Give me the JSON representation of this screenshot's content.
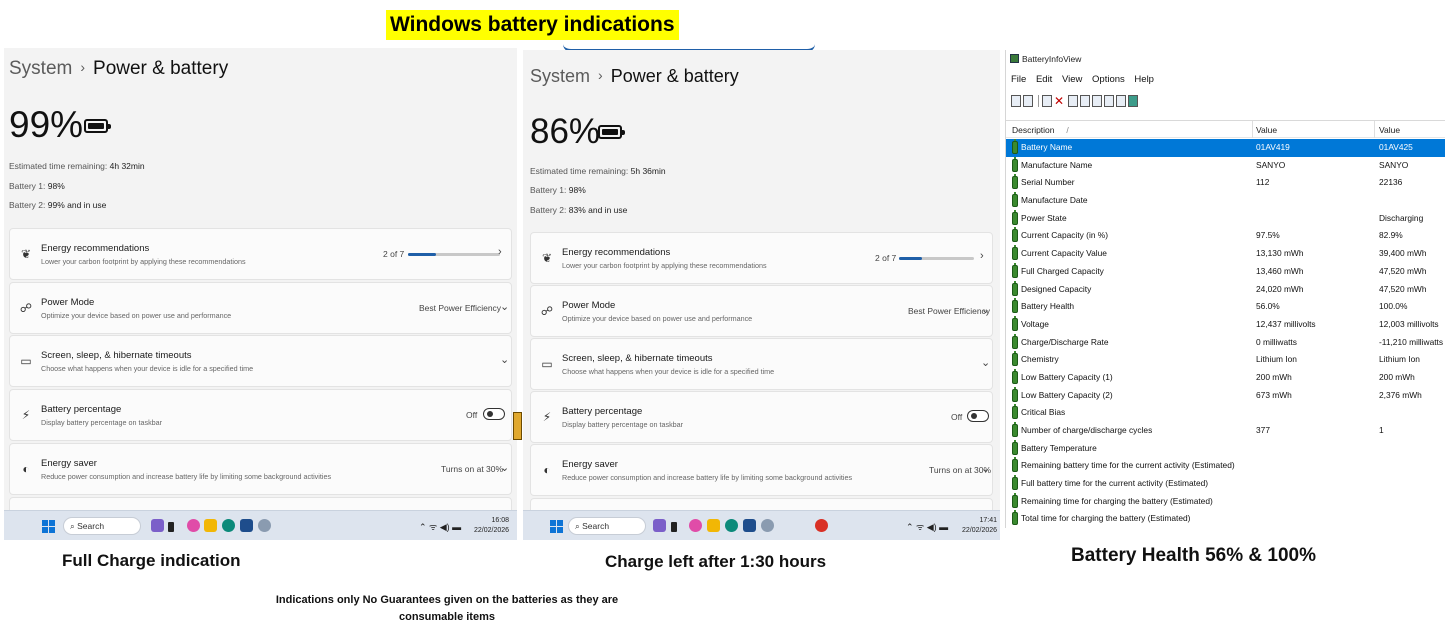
{
  "page_title": "Windows battery indications",
  "settings_panels": [
    {
      "breadcrumb_root": "System",
      "breadcrumb_current": "Power & battery",
      "percent": "99%",
      "estimated_label": "Estimated time remaining:",
      "estimated_value": "4h 32min",
      "battery1_label": "Battery 1:",
      "battery1_value": "98%",
      "battery2_label": "Battery 2:",
      "battery2_value": "99% and in use",
      "energy_recommendations": {
        "title": "Energy recommendations",
        "subtitle": "Lower your carbon footprint by applying these recommendations",
        "value": "2 of 7",
        "progress_fraction": 0.3
      },
      "power_mode": {
        "title": "Power Mode",
        "subtitle": "Optimize your device based on power use and performance",
        "value": "Best Power Efficiency"
      },
      "screen_sleep": {
        "title": "Screen, sleep, & hibernate timeouts",
        "subtitle": "Choose what happens when your device is idle for a specified time"
      },
      "battery_percentage": {
        "title": "Battery percentage",
        "subtitle": "Display battery percentage on taskbar",
        "value": "Off"
      },
      "energy_saver": {
        "title": "Energy saver",
        "subtitle": "Reduce power consumption and increase battery life by limiting some background activities",
        "value": "Turns on at 30%"
      },
      "taskbar": {
        "search": "Search",
        "time": "16:08",
        "date": "22/02/2026"
      }
    },
    {
      "breadcrumb_root": "System",
      "breadcrumb_current": "Power & battery",
      "percent": "86%",
      "estimated_label": "Estimated time remaining:",
      "estimated_value": "5h 36min",
      "battery1_label": "Battery 1:",
      "battery1_value": "98%",
      "battery2_label": "Battery 2:",
      "battery2_value": "83% and in use",
      "energy_recommendations": {
        "title": "Energy recommendations",
        "subtitle": "Lower your carbon footprint by applying these recommendations",
        "value": "2 of 7",
        "progress_fraction": 0.3
      },
      "power_mode": {
        "title": "Power Mode",
        "subtitle": "Optimize your device based on power use and performance",
        "value": "Best Power Efficiency"
      },
      "screen_sleep": {
        "title": "Screen, sleep, & hibernate timeouts",
        "subtitle": "Choose what happens when your device is idle for a specified time"
      },
      "battery_percentage": {
        "title": "Battery percentage",
        "subtitle": "Display battery percentage on taskbar",
        "value": "Off"
      },
      "energy_saver": {
        "title": "Energy saver",
        "subtitle": "Reduce power consumption and increase battery life by limiting some background activities",
        "value": "Turns on at 30%"
      },
      "taskbar": {
        "search": "Search",
        "time": "17:41",
        "date": "22/02/2026"
      }
    }
  ],
  "battery_info_view": {
    "title": "BatteryInfoView",
    "menu": [
      "File",
      "Edit",
      "View",
      "Options",
      "Help"
    ],
    "columns": [
      "Description",
      "Value",
      "Value"
    ],
    "sort_mark": "/",
    "rows": [
      {
        "desc": "Battery Name",
        "v1": "01AV419",
        "v2": "01AV425"
      },
      {
        "desc": "Manufacture Name",
        "v1": "SANYO",
        "v2": "SANYO"
      },
      {
        "desc": "Serial Number",
        "v1": " 112",
        "v2": "22136"
      },
      {
        "desc": "Manufacture Date",
        "v1": "",
        "v2": ""
      },
      {
        "desc": "Power State",
        "v1": "",
        "v2": "Discharging"
      },
      {
        "desc": "Current Capacity (in %)",
        "v1": "97.5%",
        "v2": "82.9%"
      },
      {
        "desc": "Current Capacity Value",
        "v1": "13,130 mWh",
        "v2": "39,400 mWh"
      },
      {
        "desc": "Full Charged Capacity",
        "v1": "13,460 mWh",
        "v2": "47,520 mWh"
      },
      {
        "desc": "Designed Capacity",
        "v1": "24,020 mWh",
        "v2": "47,520 mWh"
      },
      {
        "desc": "Battery Health",
        "v1": "56.0%",
        "v2": "100.0%"
      },
      {
        "desc": "Voltage",
        "v1": "12,437 millivolts",
        "v2": "12,003 millivolts"
      },
      {
        "desc": "Charge/Discharge Rate",
        "v1": "0 milliwatts",
        "v2": "-11,210 milliwatts"
      },
      {
        "desc": "Chemistry",
        "v1": "Lithium Ion",
        "v2": "Lithium Ion"
      },
      {
        "desc": "Low Battery Capacity (1)",
        "v1": "200 mWh",
        "v2": "200 mWh"
      },
      {
        "desc": "Low Battery Capacity (2)",
        "v1": "673 mWh",
        "v2": "2,376 mWh"
      },
      {
        "desc": "Critical Bias",
        "v1": "",
        "v2": ""
      },
      {
        "desc": "Number of charge/discharge cycles",
        "v1": "377",
        "v2": "1"
      },
      {
        "desc": "Battery Temperature",
        "v1": "",
        "v2": ""
      },
      {
        "desc": "Remaining battery time for the current activity (Estimated)",
        "v1": "",
        "v2": ""
      },
      {
        "desc": "Full battery time for the current activity (Estimated)",
        "v1": "",
        "v2": ""
      },
      {
        "desc": "Remaining time for charging the battery (Estimated)",
        "v1": "",
        "v2": ""
      },
      {
        "desc": "Total  time for charging the battery (Estimated)",
        "v1": "",
        "v2": ""
      }
    ]
  },
  "captions": {
    "full_charge": "Full Charge indication",
    "after_time": "Charge left after 1:30 hours",
    "health": "Battery Health 56% & 100%"
  },
  "disclaimer": "Indications only No Guarantees given on the batteries as they are consumable items",
  "colors": {
    "highlight": "#ffff00",
    "accent": "#1f5fa8",
    "selection": "#0078d7",
    "battery_icon": "#3b8a2f"
  }
}
